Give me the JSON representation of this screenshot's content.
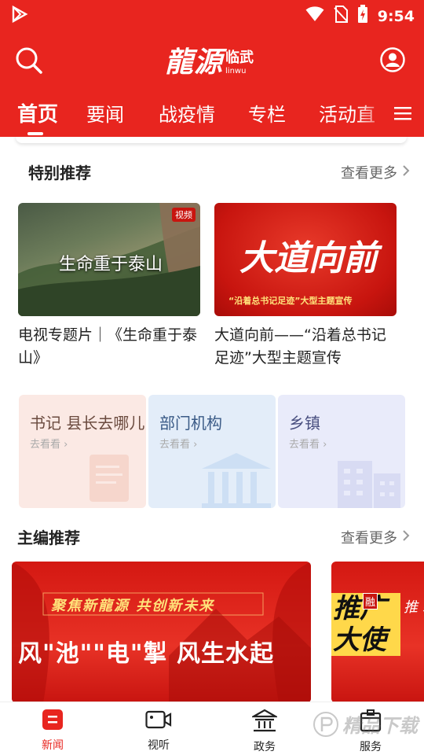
{
  "status_bar": {
    "time": "9:54"
  },
  "header": {
    "logo_text": "龍源",
    "logo_city": "临武",
    "logo_pinyin": "linwu"
  },
  "tabs": [
    {
      "label": "首页",
      "active": true
    },
    {
      "label": "要闻"
    },
    {
      "label": "战疫情"
    },
    {
      "label": "专栏"
    },
    {
      "label": "活动直"
    }
  ],
  "special": {
    "title": "特别推荐",
    "more": "查看更多",
    "cards": [
      {
        "title": "电视专题片｜《生命重于泰山》",
        "image_text": "生命重于泰山",
        "badge": "视频"
      },
      {
        "title": "大道向前——“沿着总书记足迹”大型主题宣传",
        "image_text": "大道向前",
        "image_sub": "“沿着总书记足迹”大型主题宣传"
      }
    ]
  },
  "quick_links": [
    {
      "title": "书记 县长去哪儿",
      "sub": "去看看",
      "color": "#fbe9e4",
      "text_color": "#6a4a3e"
    },
    {
      "title": "部门机构",
      "sub": "去看看",
      "color": "#e3edf9",
      "text_color": "#3a5a86"
    },
    {
      "title": "乡镇",
      "sub": "去看看",
      "color": "#e9ebfa",
      "text_color": "#4a5080"
    }
  ],
  "editor": {
    "title": "主编推荐",
    "more": "查看更多",
    "banner1": {
      "top": "聚焦新龍源 共创新未来",
      "main": "风\"池\"\"电\"掣 风生水起"
    },
    "banner2": {
      "main": "推广大使",
      "badge": "融",
      "side": "推 新"
    }
  },
  "bottom_nav": [
    {
      "label": "新闻",
      "icon": "news-icon",
      "active": true
    },
    {
      "label": "视听",
      "icon": "video-icon"
    },
    {
      "label": "政务",
      "icon": "government-icon"
    },
    {
      "label": "服务",
      "icon": "service-icon"
    }
  ],
  "watermark": "精品下载",
  "colors": {
    "brand": "#e8251f"
  }
}
